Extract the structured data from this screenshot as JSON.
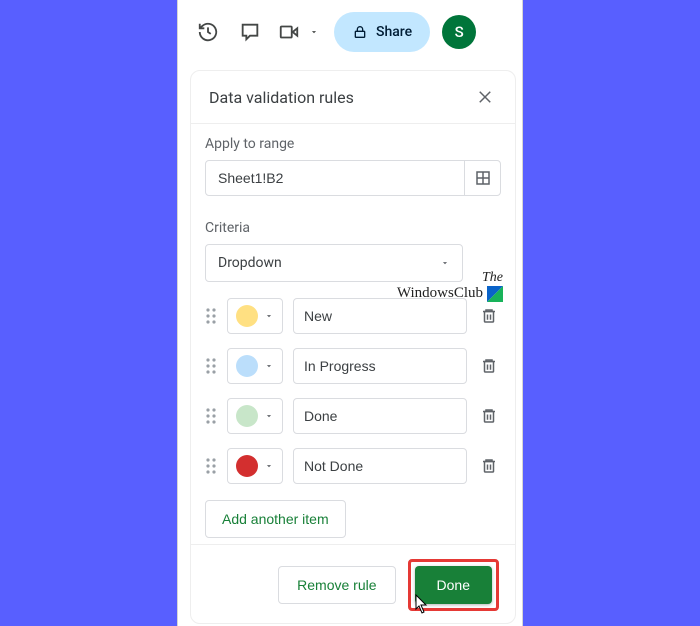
{
  "toolbar": {
    "share_label": "Share",
    "avatar_initial": "S"
  },
  "panel": {
    "title": "Data validation rules",
    "apply_label": "Apply to range",
    "range_value": "Sheet1!B2",
    "criteria_label": "Criteria",
    "criteria_value": "Dropdown",
    "add_item_label": "Add another item",
    "remove_label": "Remove rule",
    "done_label": "Done",
    "options": [
      {
        "label": "New",
        "color": "#ffe082"
      },
      {
        "label": "In Progress",
        "color": "#bbdefb"
      },
      {
        "label": "Done",
        "color": "#c8e6c9"
      },
      {
        "label": "Not Done",
        "color": "#d32f2f"
      }
    ]
  },
  "watermark": {
    "line1": "The",
    "line2": "WindowsClub"
  }
}
